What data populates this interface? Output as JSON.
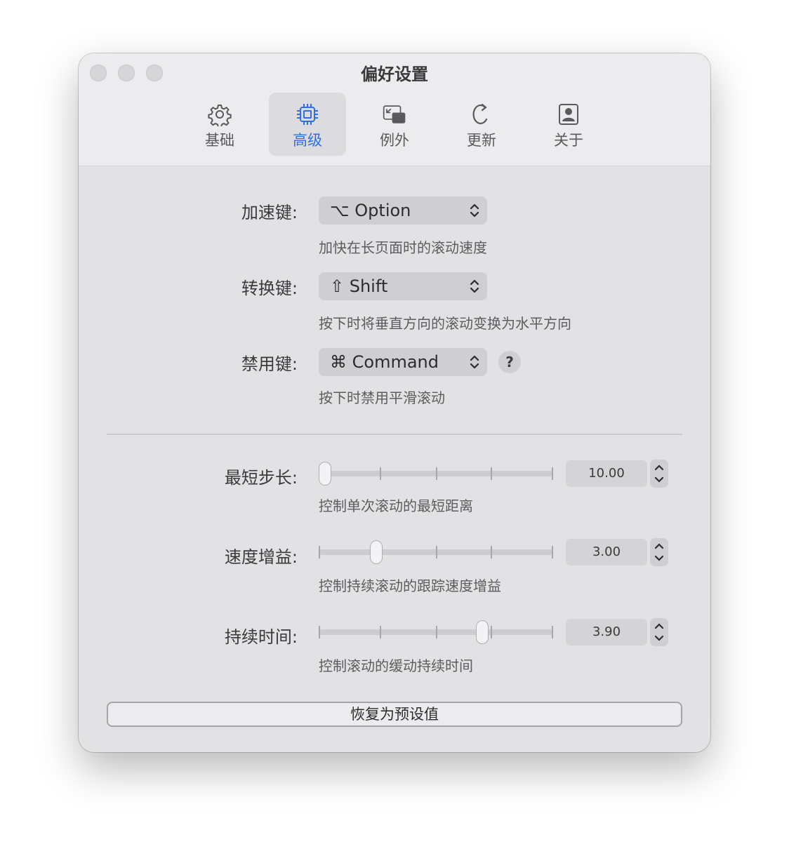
{
  "window": {
    "title": "偏好设置"
  },
  "tabs": [
    {
      "label": "基础",
      "icon": "gear-icon"
    },
    {
      "label": "高级",
      "icon": "chip-icon",
      "active": true
    },
    {
      "label": "例外",
      "icon": "window-exception-icon"
    },
    {
      "label": "更新",
      "icon": "refresh-icon"
    },
    {
      "label": "关于",
      "icon": "person-card-icon"
    }
  ],
  "accent_color": "#2f6fe0",
  "keys": {
    "accelerate": {
      "label": "加速键:",
      "value": "⌥ Option",
      "desc": "加快在长页面时的滚动速度"
    },
    "convert": {
      "label": "转换键:",
      "value": "⇧ Shift",
      "desc": "按下时将垂直方向的滚动变换为水平方向"
    },
    "disable": {
      "label": "禁用键:",
      "value": "⌘ Command",
      "desc": "按下时禁用平滑滚动",
      "help": "?"
    }
  },
  "sliders": {
    "min_step": {
      "label": "最短步长:",
      "value": "10.00",
      "position": 0.0,
      "desc": "控制单次滚动的最短距离"
    },
    "speed_gain": {
      "label": "速度增益:",
      "value": "3.00",
      "position": 0.23,
      "desc": "控制持续滚动的跟踪速度增益"
    },
    "duration": {
      "label": "持续时间:",
      "value": "3.90",
      "position": 0.71,
      "desc": "控制滚动的缓动持续时间"
    }
  },
  "reset_button": "恢复为预设值"
}
